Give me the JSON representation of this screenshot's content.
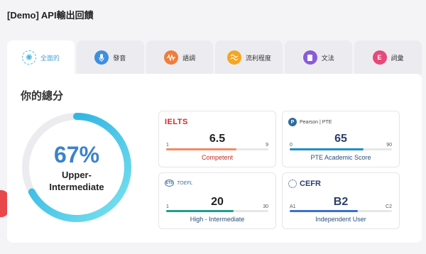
{
  "page": {
    "title": "[Demo] API輸出回饋"
  },
  "tabs": [
    {
      "label": "全面的",
      "icon": "overall-icon",
      "icon_glyph": "✺",
      "color": "#4ab8d8",
      "active": true
    },
    {
      "label": "發音",
      "icon": "microphone-icon",
      "icon_glyph": "🎤",
      "color": "#3d8fe0",
      "active": false
    },
    {
      "label": "語調",
      "icon": "waveform-icon",
      "icon_glyph": "〜",
      "color": "#f07d3a",
      "active": false
    },
    {
      "label": "流利程度",
      "icon": "fluency-icon",
      "icon_glyph": "≋",
      "color": "#f5a623",
      "active": false
    },
    {
      "label": "文法",
      "icon": "book-icon",
      "icon_glyph": "▮",
      "color": "#8a5cd6",
      "active": false
    },
    {
      "label": "詞彙",
      "icon": "letter-e-icon",
      "icon_glyph": "E",
      "color": "#e8487a",
      "active": false
    }
  ],
  "overall": {
    "heading": "你的總分",
    "percent_text": "67%",
    "percent": 0.67,
    "level": "Upper-Intermediate",
    "ring_colors": {
      "start": "#7be3f0",
      "end": "#1aa7e0",
      "track": "#ececf0"
    }
  },
  "cards": {
    "ielts": {
      "logo": "IELTS",
      "value": "6.5",
      "min": "1",
      "max": "9",
      "band": "Competent",
      "band_color": "#c62828",
      "fill": 0.69,
      "fill_color": "#f28b63"
    },
    "pte": {
      "logo": "Pearson | PTE",
      "logo_mark": "P",
      "value": "65",
      "min": "0",
      "max": "90",
      "band": "PTE Academic Score",
      "band_color": "#2b4f7a",
      "fill": 0.72,
      "fill_color": "#1f8fc6"
    },
    "toefl": {
      "logo": "TOEFL",
      "logo_mark": "ETS",
      "value": "20",
      "min": "1",
      "max": "30",
      "band": "High - Intermediate",
      "band_color": "#2b4f7a",
      "fill": 0.66,
      "fill_color": "#1f9e8f"
    },
    "cefr": {
      "logo": "CEFR",
      "value": "B2",
      "min": "A1",
      "max": "C2",
      "band": "Independent User",
      "band_color": "#2b4f7a",
      "fill": 0.67,
      "fill_color": "#3b6fd6"
    }
  }
}
